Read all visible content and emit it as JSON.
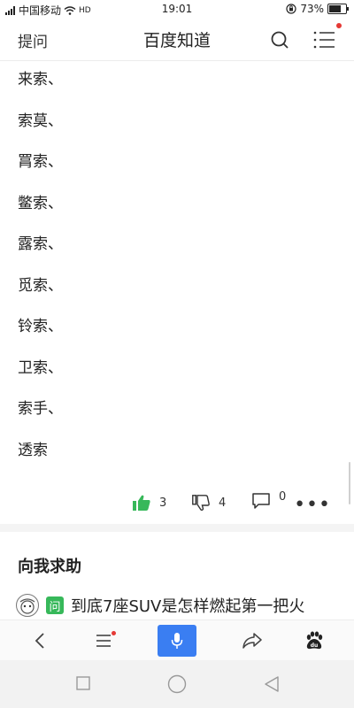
{
  "status_bar": {
    "carrier": "中国移动",
    "network_label": "HD",
    "time": "19:01",
    "battery_percent": "73%",
    "battery_level": 0.73
  },
  "header": {
    "ask_label": "提问",
    "title": "百度知道",
    "icons": [
      "search-icon",
      "menu-icon"
    ]
  },
  "answer": {
    "lines": [
      "来索、",
      "索莫、",
      "罥索、",
      "鳖索、",
      "露索、",
      "觅索、",
      "铃索、",
      "卫索、",
      "索手、",
      "透索"
    ]
  },
  "actions": {
    "likes": "3",
    "dislikes": "4",
    "comments": "0",
    "more": "•••"
  },
  "help": {
    "title": "向我求助",
    "badge": "问",
    "question": "到底7座SUV是怎样燃起第一把火"
  },
  "colors": {
    "like_green": "#37b85a",
    "mic_blue": "#3a7ef2",
    "notif_red": "#e53935"
  }
}
